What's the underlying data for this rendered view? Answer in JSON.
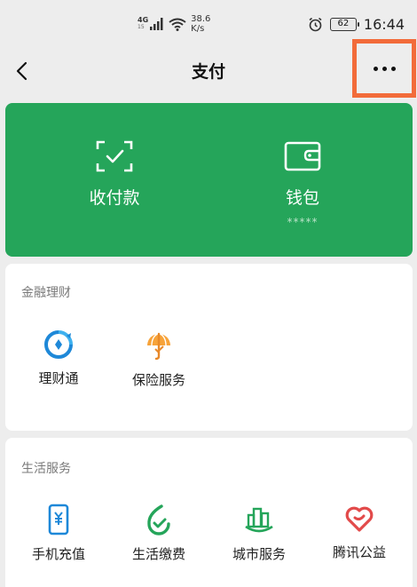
{
  "status_bar": {
    "network": "4G",
    "network_sub": "15",
    "speed_value": "38.6",
    "speed_unit": "K/s",
    "battery": "62",
    "time": "16:44"
  },
  "nav": {
    "title": "支付",
    "back_icon": "chevron-left-icon",
    "more_icon": "more-dots-icon",
    "highlight_color": "#f26b3a"
  },
  "pay_card": {
    "color": "#25a55a",
    "collect_label": "收付款",
    "wallet_label": "钱包",
    "wallet_balance": "*****"
  },
  "finance": {
    "title": "金融理财",
    "items": [
      {
        "label": "理财通",
        "icon": "licaitong-icon"
      },
      {
        "label": "保险服务",
        "icon": "insurance-umbrella-icon"
      }
    ]
  },
  "life": {
    "title": "生活服务",
    "items": [
      {
        "label": "手机充值",
        "icon": "phone-recharge-icon"
      },
      {
        "label": "生活缴费",
        "icon": "utility-payment-icon"
      },
      {
        "label": "城市服务",
        "icon": "city-services-icon"
      },
      {
        "label": "腾讯公益",
        "icon": "charity-heart-icon"
      }
    ]
  }
}
